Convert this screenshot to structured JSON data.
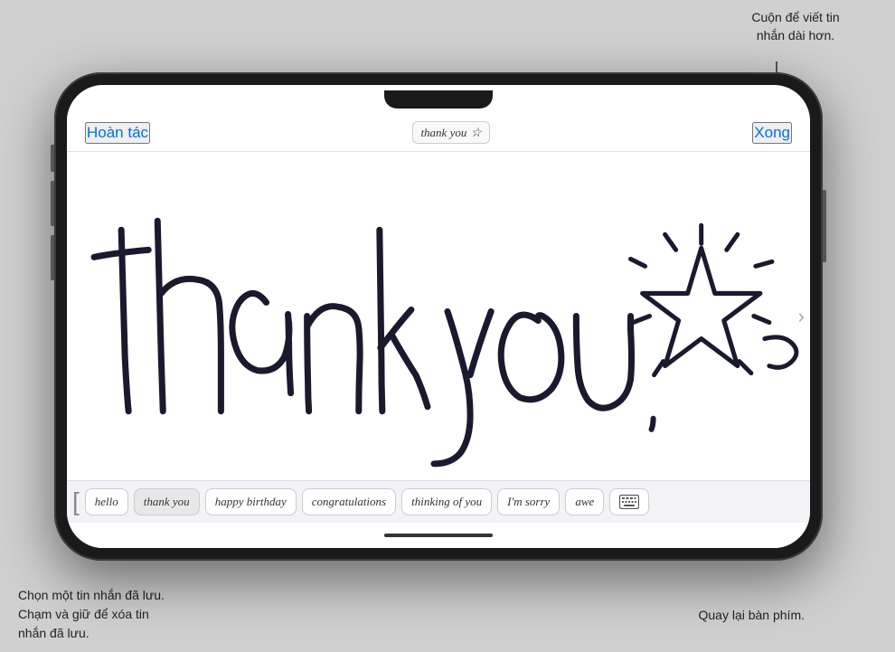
{
  "callout": {
    "top_right": "Cuộn để viết tin\nnhắn dài hơn.",
    "bottom_left_line1": "Chọn một tin nhắn đã lưu.",
    "bottom_left_line2": "Chạm và giữ để xóa tin",
    "bottom_left_line3": "nhắn đã lưu.",
    "bottom_right": "Quay lại bàn phím."
  },
  "header": {
    "undo": "Hoàn tác",
    "done": "Xong",
    "preview_text": "thank you",
    "preview_star": "☆"
  },
  "presets": [
    {
      "label": "hello",
      "active": false
    },
    {
      "label": "thank you",
      "active": true
    },
    {
      "label": "happy birthday",
      "active": false
    },
    {
      "label": "congratulations",
      "active": false
    },
    {
      "label": "thinking of you",
      "active": false
    },
    {
      "label": "I'm sorry",
      "active": false
    },
    {
      "label": "awe",
      "active": false
    }
  ],
  "canvas": {
    "handwriting_text": "thank you"
  },
  "next_arrow": "›"
}
